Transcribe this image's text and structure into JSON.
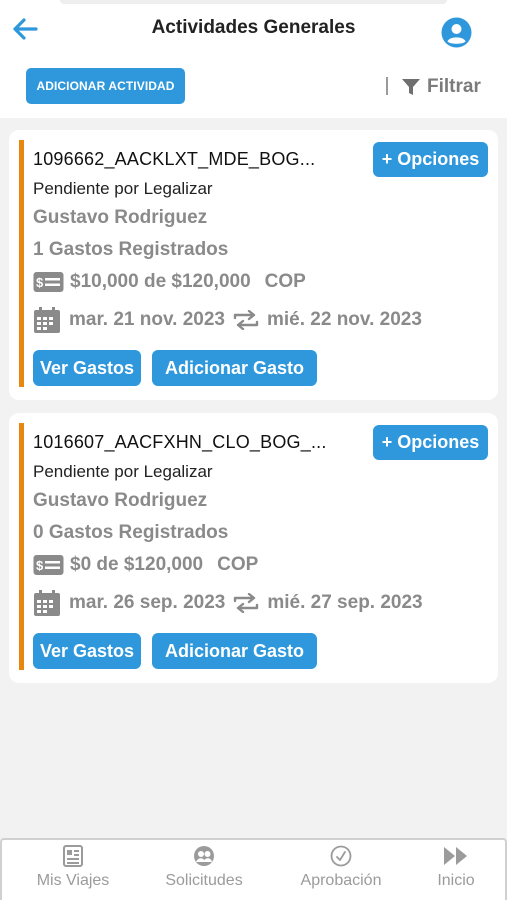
{
  "header": {
    "title": "Actividades Generales",
    "back_icon": "arrow-left-icon",
    "profile_icon": "user-circle-icon",
    "accent_color": "#2f98dc"
  },
  "toolbar": {
    "add_activity_label": "ADICIONAR ACTIVIDAD",
    "filter_label": "Filtrar",
    "filter_icon": "funnel-icon"
  },
  "activities": [
    {
      "code": "1096662_AACKLXT_MDE_BOG...",
      "options_label": "+ Opciones",
      "status": "Pendiente por Legalizar",
      "person": "Gustavo Rodriguez",
      "expenses_count": "1 Gastos Registrados",
      "amount": "$10,000 de $120,000",
      "currency": "COP",
      "start_date": "mar. 21 nov. 2023",
      "end_date": "mié. 22 nov. 2023",
      "view_expenses_label": "Ver Gastos",
      "add_expense_label": "Adicionar Gasto"
    },
    {
      "code": "1016607_AACFXHN_CLO_BOG_...",
      "options_label": "+ Opciones",
      "status": "Pendiente por Legalizar",
      "person": "Gustavo Rodriguez",
      "expenses_count": "0 Gastos Registrados",
      "amount": "$0 de $120,000",
      "currency": "COP",
      "start_date": "mar. 26 sep. 2023",
      "end_date": "mié. 27 sep. 2023",
      "view_expenses_label": "Ver Gastos",
      "add_expense_label": "Adicionar Gasto"
    }
  ],
  "bottom_nav": {
    "items": [
      {
        "label": "Mis Viajes",
        "icon": "document-icon"
      },
      {
        "label": "Solicitudes",
        "icon": "people-icon"
      },
      {
        "label": "Aprobación",
        "icon": "check-circle-icon"
      },
      {
        "label": "Inicio",
        "icon": "fast-forward-icon"
      }
    ]
  },
  "colors": {
    "primary": "#2f98dc",
    "accent_bar": "#e8870e",
    "muted_text": "#8a8a8a",
    "background": "#f2f2f2"
  }
}
